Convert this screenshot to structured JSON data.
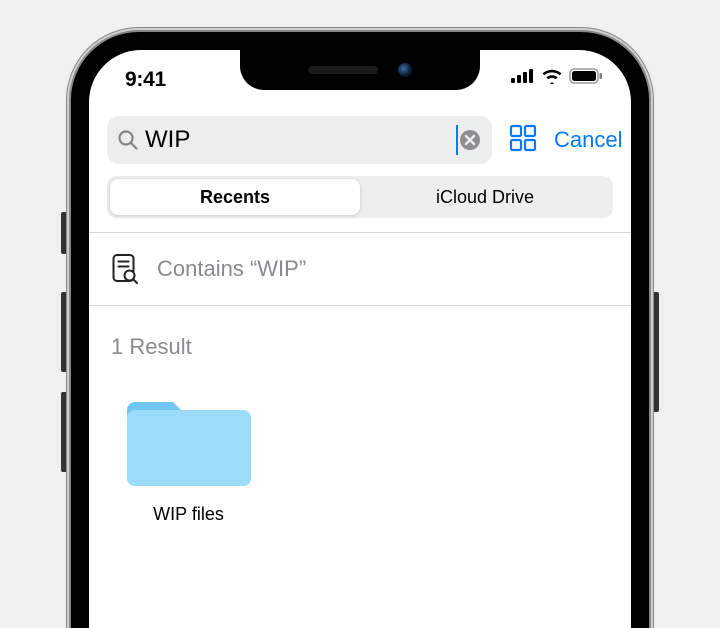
{
  "status": {
    "time": "9:41"
  },
  "search": {
    "value": "WIP",
    "clear_icon": "clear",
    "view_icon": "grid",
    "cancel_label": "Cancel"
  },
  "scope": {
    "tabs": [
      "Recents",
      "iCloud Drive"
    ],
    "active_index": 0
  },
  "suggestion": {
    "text": "Contains “WIP”"
  },
  "results": {
    "header": "1 Result",
    "items": [
      {
        "name": "WIP files",
        "type": "folder"
      }
    ]
  }
}
